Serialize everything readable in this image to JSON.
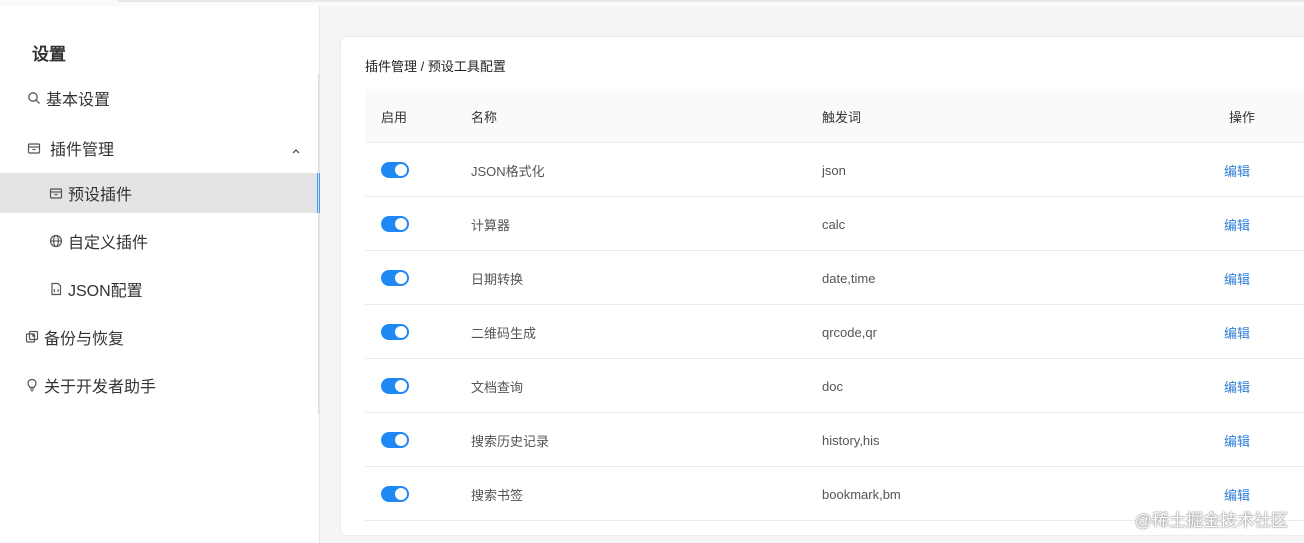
{
  "sidebar": {
    "title": "设置",
    "items": [
      {
        "label": "基本设置",
        "icon": "search-icon"
      },
      {
        "label": "插件管理",
        "icon": "box-icon",
        "expanded": true
      },
      {
        "label": "预设插件",
        "icon": "box-icon",
        "active": true
      },
      {
        "label": "自定义插件",
        "icon": "globe-icon"
      },
      {
        "label": "JSON配置",
        "icon": "file-code-icon"
      },
      {
        "label": "备份与恢复",
        "icon": "backup-icon"
      },
      {
        "label": "关于开发者助手",
        "icon": "bulb-icon"
      }
    ]
  },
  "breadcrumb": "插件管理 / 预设工具配置",
  "table": {
    "headers": {
      "enable": "启用",
      "name": "名称",
      "trigger": "触发词",
      "op": "操作"
    },
    "rows": [
      {
        "enabled": true,
        "name": "JSON格式化",
        "trigger": "json",
        "op": "编辑"
      },
      {
        "enabled": true,
        "name": "计算器",
        "trigger": "calc",
        "op": "编辑"
      },
      {
        "enabled": true,
        "name": "日期转换",
        "trigger": "date,time",
        "op": "编辑"
      },
      {
        "enabled": true,
        "name": "二维码生成",
        "trigger": "qrcode,qr",
        "op": "编辑"
      },
      {
        "enabled": true,
        "name": "文档查询",
        "trigger": "doc",
        "op": "编辑"
      },
      {
        "enabled": true,
        "name": "搜索历史记录",
        "trigger": "history,his",
        "op": "编辑"
      },
      {
        "enabled": true,
        "name": "搜索书签",
        "trigger": "bookmark,bm",
        "op": "编辑"
      }
    ]
  },
  "watermark": "@稀土掘金技术社区",
  "colors": {
    "accent": "#1e88f5",
    "link": "#2f7fd6",
    "active_bg": "#e4e4e4"
  }
}
